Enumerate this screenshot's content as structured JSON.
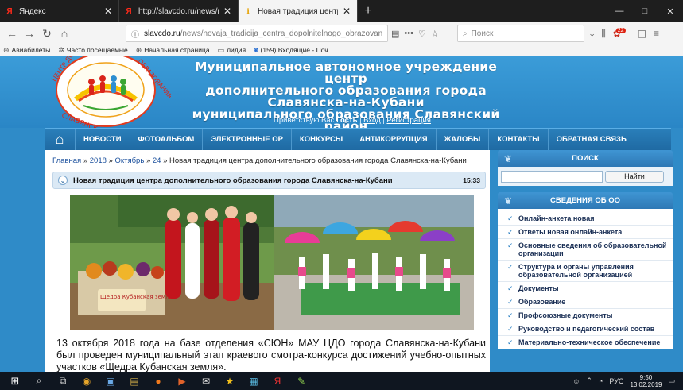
{
  "browser": {
    "tabs": [
      {
        "title": "Яндекс",
        "icon": "yandex-icon",
        "active": false
      },
      {
        "title": "http://slavcdo.ru/news/novaja",
        "icon": "yandex-icon",
        "active": false
      },
      {
        "title": "Новая традиция центра допол",
        "icon": "site-icon",
        "active": true
      }
    ],
    "new_tab": "+",
    "window_controls": [
      "—",
      "□",
      "✕"
    ],
    "url_host": "slavcdo.ru",
    "url_path": "/news/novaja_tradicija_centra_dopolnitelnogo_obrazovanija_gor",
    "search_placeholder": "Поиск",
    "notification_count": "22",
    "bookmarks": [
      "Авиабилеты",
      "Часто посещаемые",
      "Начальная страница",
      "лидия",
      "(159) Входящие - Поч..."
    ]
  },
  "site": {
    "title_lines": [
      "Муниципальное автономное учреждение центр",
      "дополнительного образования города Славянска-на-Кубани",
      "муниципального образования Славянский район"
    ],
    "logo_ring_text_left": "ЦЕНТР ДОП.",
    "logo_ring_text_right": "ОБРАЗОВАНИЯ",
    "logo_bottom_text": "СЛАВЯНСК-НА-КУБАНИ",
    "greeting_prefix": "Приветствую Вас",
    "greeting_user": "Гость",
    "greeting_sep": "|",
    "login": "Вход",
    "register": "Регистрация",
    "menu": [
      "НОВОСТИ",
      "ФОТОАЛЬБОМ",
      "ЭЛЕКТРОННЫЕ ОР",
      "КОНКУРСЫ",
      "АНТИКОРРУПЦИЯ",
      "ЖАЛОБЫ",
      "КОНТАКТЫ",
      "ОБРАТНАЯ СВЯЗЬ"
    ]
  },
  "breadcrumb": {
    "home": "Главная",
    "year": "2018",
    "month": "Октябрь",
    "day": "24",
    "sep": "»",
    "current": "Новая традиция центра дополнительного образования города Славянска-на-Кубани"
  },
  "news": {
    "title": "Новая традиция центра дополнительного образования города Славянска-на-Кубани",
    "time": "15:33",
    "banner_text": "Щедра Кубанская земля!",
    "body": "13 октября 2018 года на базе отделения «СЮН» МАУ ЦДО города Славянска-на-Кубани был проведен муниципальный этап краевого смотра-конкурса достижений учебно-опытных участков «Щедра Кубанская земля»."
  },
  "sidebar": {
    "search_title": "ПОИСК",
    "search_button": "Найти",
    "info_title": "СВЕДЕНИЯ ОБ ОО",
    "items": [
      "Онлайн-анкета новая",
      "Ответы новая онлайн-анкета",
      "Основные сведения об образовательной организации",
      "Структура и органы управления образовательной организацией",
      "Документы",
      "Образование",
      "Профсоюзные документы",
      "Руководство и педагогический состав",
      "Материально-техническое обеспечение"
    ]
  },
  "taskbar": {
    "lang": "РУС",
    "time": "9:50",
    "date": "13.02.2019"
  }
}
